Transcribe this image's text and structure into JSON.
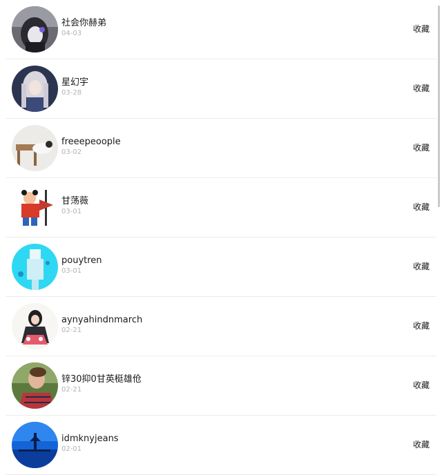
{
  "list": {
    "items": [
      {
        "name": "社会你赫弟",
        "date": "04-03",
        "action": "收藏",
        "avatar_icon": "dark-hooded-character-avatar"
      },
      {
        "name": "星幻宇",
        "date": "03-28",
        "action": "收藏",
        "avatar_icon": "anime-girl-avatar"
      },
      {
        "name": "freeepeoople",
        "date": "03-02",
        "action": "收藏",
        "avatar_icon": "lying-figure-avatar"
      },
      {
        "name": "甘荡薇",
        "date": "03-01",
        "action": "收藏",
        "avatar_icon": "cartoon-warrior-avatar"
      },
      {
        "name": "pouytren",
        "date": "03-01",
        "action": "收藏",
        "avatar_icon": "cyan-clothes-avatar"
      },
      {
        "name": "aynyahindnmarch",
        "date": "02-21",
        "action": "收藏",
        "avatar_icon": "illustrated-girl-avatar"
      },
      {
        "name": "锌30抑0甘英梃雄伧",
        "date": "02-21",
        "action": "收藏",
        "avatar_icon": "man-profile-avatar"
      },
      {
        "name": "idmknyjeans",
        "date": "02-01",
        "action": "收藏",
        "avatar_icon": "night-sky-lighthouse-avatar"
      }
    ]
  },
  "colors": {
    "name_text": "#1a1a1a",
    "date_text": "#b2b2b2",
    "divider": "#ececec",
    "background": "#ffffff"
  }
}
